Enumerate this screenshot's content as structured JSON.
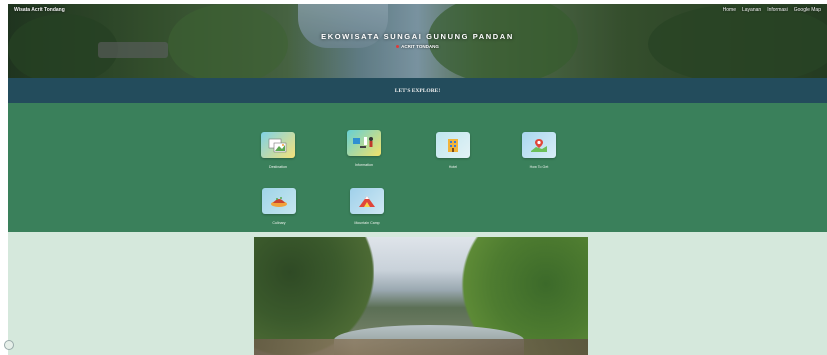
{
  "header": {
    "brand": "Wisata Acrit Tondang",
    "nav": [
      "Home",
      "Layanan",
      "Informasi",
      "Google Map"
    ],
    "title": "EKOWISATA SUNGAI GUNUNG PANDAN",
    "subtitle": "ACRIT TONDANG"
  },
  "band": {
    "label": "LET'S EXPLORE!"
  },
  "tiles": [
    {
      "label": "Destination",
      "icon": "gallery-photo-icon"
    },
    {
      "label": "Information",
      "icon": "information-people-icon"
    },
    {
      "label": "Hotel",
      "icon": "hotel-building-icon"
    },
    {
      "label": "How To Get",
      "icon": "map-pin-icon"
    },
    {
      "label": "Culinary",
      "icon": "culinary-food-icon"
    },
    {
      "label": "Mountain Camp",
      "icon": "mountain-tent-icon"
    }
  ],
  "colors": {
    "band": "#234c5c",
    "explore": "#3a805b",
    "bottom": "#d5e8dc"
  }
}
